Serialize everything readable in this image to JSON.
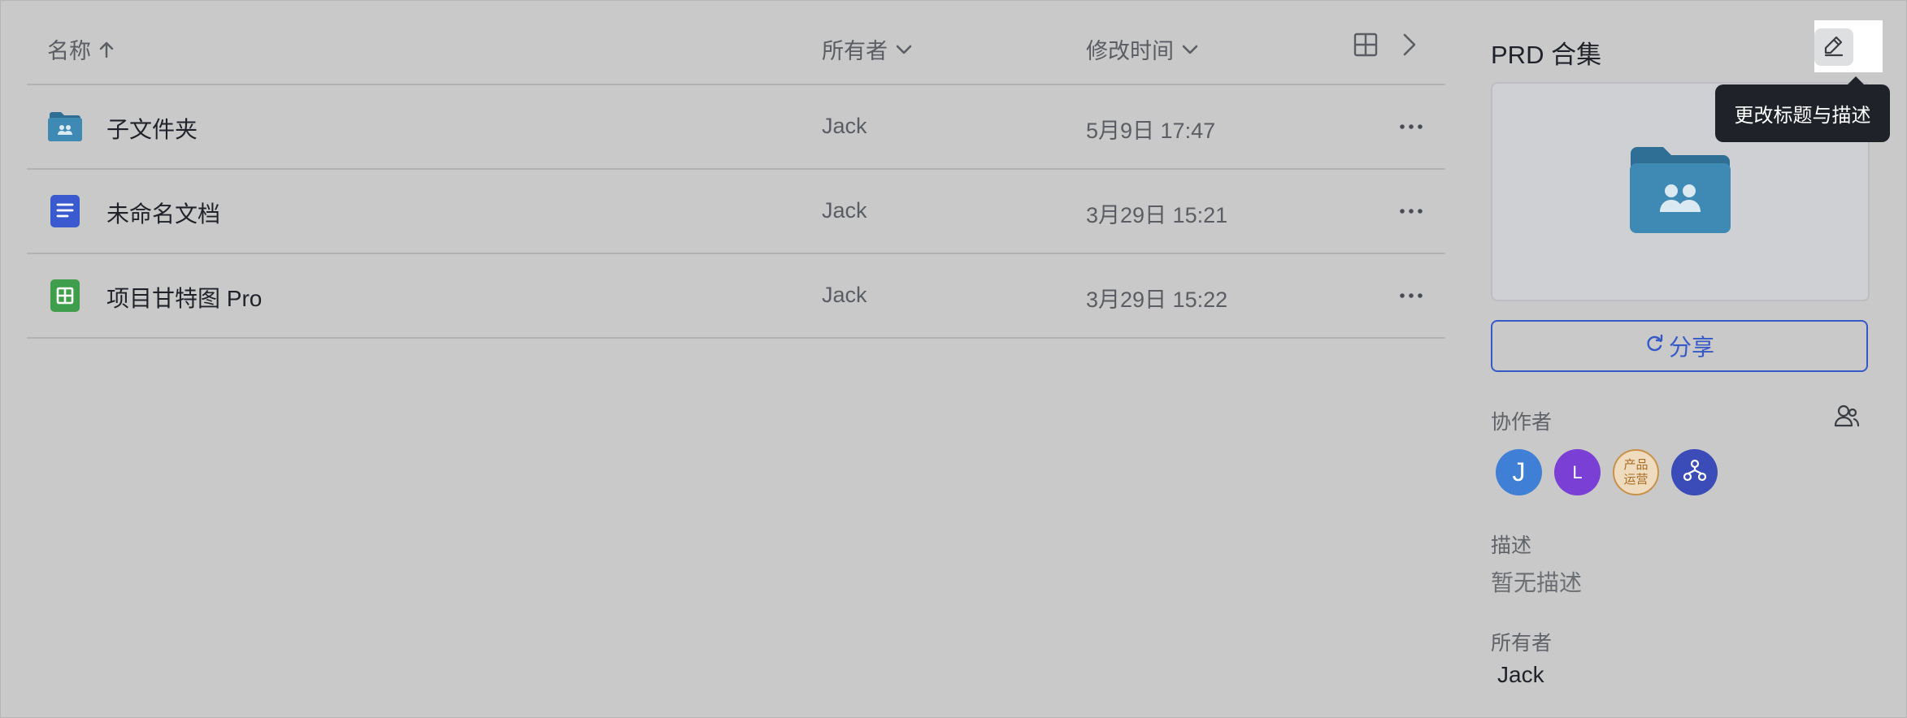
{
  "list": {
    "columns": {
      "name": "名称",
      "owner": "所有者",
      "modified": "修改时间"
    },
    "sort_icon": "arrow-up-icon",
    "view_icon": "grid-view-icon",
    "expand_icon": "chevron-right-icon",
    "files": [
      {
        "name": "子文件夹",
        "owner": "Jack",
        "modified": "5月9日 17:47",
        "icon": "shared-folder-icon"
      },
      {
        "name": "未命名文档",
        "owner": "Jack",
        "modified": "3月29日 15:21",
        "icon": "doc-icon"
      },
      {
        "name": "项目甘特图 Pro",
        "owner": "Jack",
        "modified": "3月29日 15:22",
        "icon": "sheet-icon"
      }
    ]
  },
  "panel": {
    "title": "PRD 合集",
    "edit_tooltip": "更改标题与描述",
    "share_label": "分享",
    "collaborators_label": "协作者",
    "collaborators": [
      {
        "initial": "J",
        "color": "#3f7fd6"
      },
      {
        "initial": "L",
        "color": "#7a3fd4"
      },
      {
        "initial": "产品\n运营",
        "color": "#d9a860"
      },
      {
        "initial": "",
        "color": "#3b4bb8"
      }
    ],
    "description_label": "描述",
    "description_value": "暂无描述",
    "owner_label": "所有者",
    "owner_value": "Jack"
  },
  "colors": {
    "accent": "#3559c7",
    "background": "#c9c9c9",
    "folder": "#3f8ab5",
    "doc": "#3a5bcf",
    "sheet": "#3f9e4a"
  }
}
